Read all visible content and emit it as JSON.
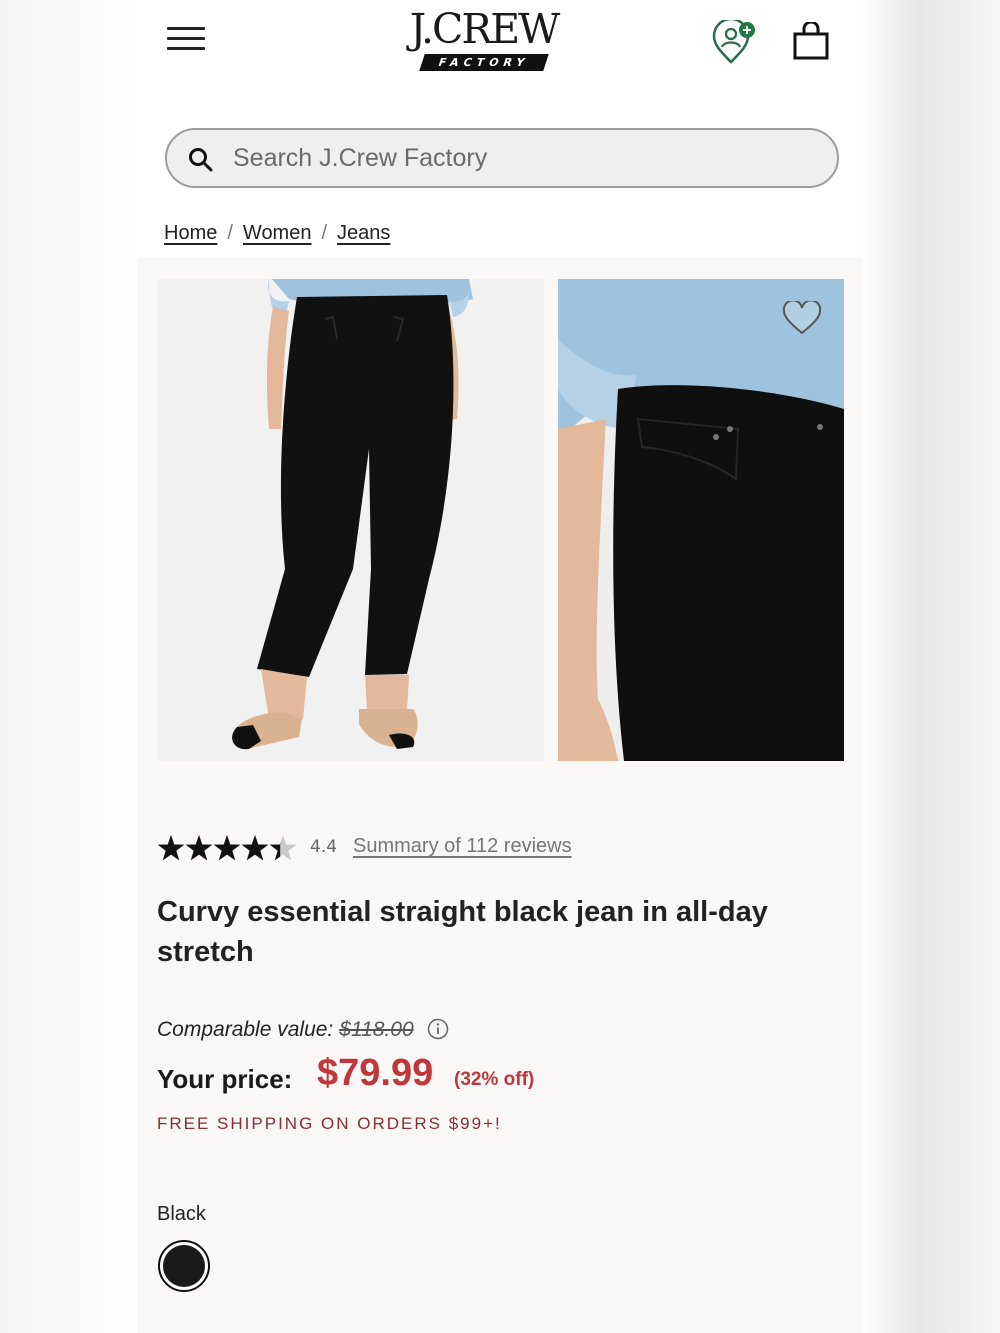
{
  "header": {
    "logo_main": "J.CREW",
    "logo_sub": "FACTORY"
  },
  "search": {
    "placeholder": "Search J.Crew Factory"
  },
  "breadcrumb": {
    "items": [
      "Home",
      "Women",
      "Jeans"
    ],
    "separator": "/"
  },
  "product": {
    "rating_value": "4.4",
    "rating_stars": 4.4,
    "reviews_link": "Summary of 112 reviews",
    "title": "Curvy essential straight black jean in all-day stretch",
    "comparable_label": "Comparable value:",
    "comparable_price": "$118.00",
    "price_label": "Your price:",
    "price": "$79.99",
    "discount": "(32% off)",
    "shipping_note": "FREE SHIPPING ON ORDERS $99+!",
    "color_label": "Black",
    "swatch_color": "#1a1a1a"
  },
  "colors": {
    "accent_red": "#c0363a",
    "shipping_red": "#8b2d2d",
    "loyalty_green": "#1f7a45"
  },
  "icons": [
    "menu-icon",
    "account-plus-icon",
    "shopping-bag-icon",
    "search-icon",
    "heart-icon",
    "star-icon",
    "info-icon"
  ]
}
